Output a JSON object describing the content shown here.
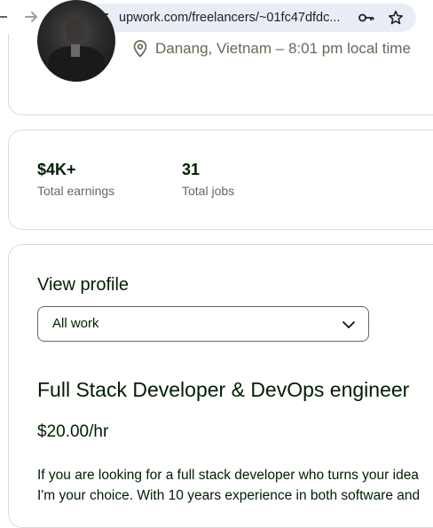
{
  "browser": {
    "url": "upwork.com/freelancers/~01fc47dfdc...",
    "icons": [
      "arrow-back-icon",
      "arrow-forward-icon",
      "reload-icon",
      "site-info-icon",
      "password-key-icon",
      "bookmark-star-icon"
    ]
  },
  "profile": {
    "location": "Danang, Vietnam – 8:01 pm local time"
  },
  "stats": [
    {
      "value": "$4K+",
      "label": "Total earnings"
    },
    {
      "value": "31",
      "label": "Total jobs"
    }
  ],
  "main": {
    "view_profile_label": "View profile",
    "work_filter": {
      "selected": "All work"
    },
    "headline": "Full Stack Developer & DevOps engineer",
    "hourly_rate": "$20.00/hr",
    "overview_lines": [
      "If you are looking for a full stack developer who turns your idea",
      "I'm your choice. With 10 years experience in both software and"
    ]
  },
  "colors": {
    "text_primary": "#001e00",
    "text_secondary": "#5e6d55",
    "card_border": "#d5e0d5",
    "omnibox_bg": "#e9eef6"
  }
}
